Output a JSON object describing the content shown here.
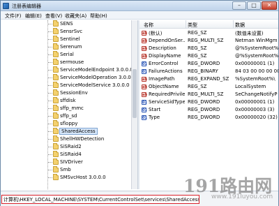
{
  "window": {
    "title": "注册表编辑器",
    "controls": {
      "minimize": "–",
      "maximize": "□",
      "close": "✕"
    }
  },
  "menu": {
    "items": [
      "文件(F)",
      "编辑(E)",
      "查看(V)",
      "收藏夹(A)",
      "帮助(H)"
    ]
  },
  "tree": {
    "items": [
      {
        "label": "SENS",
        "selected": false
      },
      {
        "label": "SensrSvc",
        "selected": false
      },
      {
        "label": "Sentinel",
        "selected": false
      },
      {
        "label": "Serenum",
        "selected": false
      },
      {
        "label": "Serial",
        "selected": false
      },
      {
        "label": "sermouse",
        "selected": false
      },
      {
        "label": "ServiceModelEndpoint 3.0.0.0",
        "selected": false
      },
      {
        "label": "ServiceModelOperation 3.0.0.0",
        "selected": false
      },
      {
        "label": "ServiceModelService 3.0.0.0",
        "selected": false
      },
      {
        "label": "SessionEnv",
        "selected": false
      },
      {
        "label": "sffdisk",
        "selected": false
      },
      {
        "label": "sffp_mmc",
        "selected": false
      },
      {
        "label": "sffp_sd",
        "selected": false
      },
      {
        "label": "sfloppy",
        "selected": false
      },
      {
        "label": "SharedAccess",
        "selected": true
      },
      {
        "label": "ShellHWDetection",
        "selected": false
      },
      {
        "label": "SiSRaid2",
        "selected": false
      },
      {
        "label": "SiSRaid4",
        "selected": false
      },
      {
        "label": "SIVDriver",
        "selected": false
      },
      {
        "label": "Smb",
        "selected": false
      },
      {
        "label": "SMSvcHost 3.0.0.0",
        "selected": false
      }
    ]
  },
  "list": {
    "columns": [
      "名称",
      "类型",
      "数据"
    ],
    "rows": [
      {
        "icon": "sz",
        "name": "(默认)",
        "type": "REG_SZ",
        "data": "(数值未设置)"
      },
      {
        "icon": "sz",
        "name": "DependOnSer...",
        "type": "REG_MULTI_SZ",
        "data": "Netman WinMgm"
      },
      {
        "icon": "sz",
        "name": "Description",
        "type": "REG_SZ",
        "data": "@%SystemRoot%"
      },
      {
        "icon": "sz",
        "name": "DisplayName",
        "type": "REG_SZ",
        "data": "@%SystemRoot%"
      },
      {
        "icon": "bin",
        "name": "ErrorControl",
        "type": "REG_DWORD",
        "data": "0x00000001 (1)"
      },
      {
        "icon": "bin",
        "name": "FailureActions",
        "type": "REG_BINARY",
        "data": "84 03 00 00 00 00"
      },
      {
        "icon": "sz",
        "name": "ImagePath",
        "type": "REG_EXPAND_SZ",
        "data": "%SystemRoot%\\"
      },
      {
        "icon": "sz",
        "name": "ObjectName",
        "type": "REG_SZ",
        "data": "LocalSystem"
      },
      {
        "icon": "sz",
        "name": "RequiredPrivile...",
        "type": "REG_MULTI_SZ",
        "data": "SeChangeNotifyP"
      },
      {
        "icon": "bin",
        "name": "ServiceSidType",
        "type": "REG_DWORD",
        "data": "0x00000001 (1)"
      },
      {
        "icon": "bin",
        "name": "Start",
        "type": "REG_DWORD",
        "data": "0x00000003 (3)"
      },
      {
        "icon": "bin",
        "name": "Type",
        "type": "REG_DWORD",
        "data": "0x00000020 (32)"
      }
    ]
  },
  "status": {
    "path": "计算机\\HKEY_LOCAL_MACHINE\\SYSTEM\\CurrentControlSet\\services\\SharedAccess"
  },
  "watermark": {
    "text": "191路由网",
    "url": "www.191luyou.com"
  },
  "colors": {
    "selection": "#d7e8fc",
    "highlight_border": "#d8202a",
    "folder": "#f4d16e"
  }
}
